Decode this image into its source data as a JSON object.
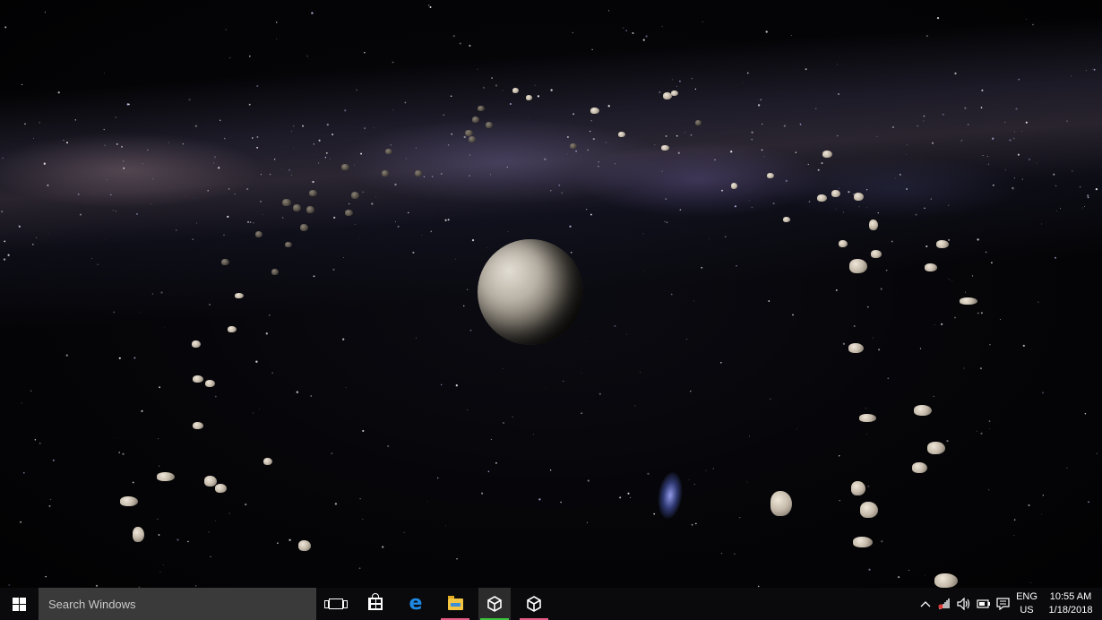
{
  "desktop": {
    "wallpaper": "space scene with moon and asteroid belt",
    "colors": {
      "sky": "#050508",
      "nebula": "#6e5f8c",
      "planet": "#b9b2a6",
      "asteroid": "#c4b9a9",
      "galaxy": "#7d8cff"
    }
  },
  "taskbar": {
    "start_icon": "windows-logo-icon",
    "search": {
      "placeholder": "Search Windows"
    },
    "task_view_icon": "task-view-icon",
    "pinned": [
      {
        "name": "store",
        "icon": "store-icon",
        "active": false
      },
      {
        "name": "edge",
        "icon": "edge-icon",
        "active": false
      },
      {
        "name": "file-explorer",
        "icon": "folder-icon",
        "active": false,
        "underline": "#e85a8a"
      },
      {
        "name": "unity-1",
        "icon": "unity-icon",
        "active": true,
        "underline": "#3ec43e"
      },
      {
        "name": "unity-2",
        "icon": "unity-icon",
        "active": false,
        "underline": "#e85a8a"
      }
    ],
    "tray": {
      "icons": [
        "chevron-up-icon",
        "network-icon",
        "volume-icon",
        "battery-icon",
        "notifications-icon"
      ],
      "language": "ENG",
      "region": "US",
      "time": "10:55 AM",
      "date": "1/18/2018"
    },
    "colors": {
      "background": "#0a0a0c",
      "search_bg": "#3a3a3a",
      "accent_edge": "#1e8ae6",
      "folder": "#f4c542"
    }
  }
}
